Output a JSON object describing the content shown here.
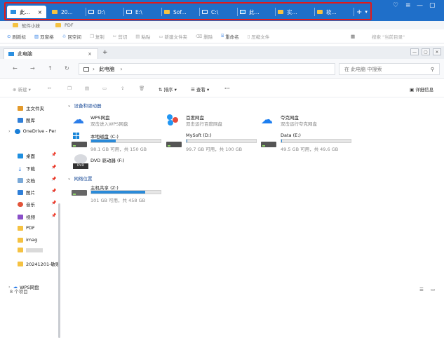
{
  "window_tabs": [
    {
      "label": "此...",
      "icon": "computer-icon",
      "active": true
    },
    {
      "label": "20...",
      "icon": "folder-icon"
    },
    {
      "label": "D:\\",
      "icon": "drive-icon"
    },
    {
      "label": "E:\\",
      "icon": "drive-icon"
    },
    {
      "label": "Sof...",
      "icon": "folder-icon"
    },
    {
      "label": "C:\\",
      "icon": "drive-icon"
    },
    {
      "label": "此...",
      "icon": "computer-icon"
    },
    {
      "label": "实...",
      "icon": "folder-icon"
    },
    {
      "label": "软...",
      "icon": "folder-icon"
    }
  ],
  "tab_close": "×",
  "new_tab": "+",
  "tab_menu": "▾",
  "window_controls": {
    "settings": "♡",
    "menu": "≡",
    "minimize": "—",
    "maximize": "▢"
  },
  "bookmarks": [
    {
      "label": "软件小妹"
    },
    {
      "label": "PDF"
    }
  ],
  "toolbar1": [
    {
      "label": "刷新标",
      "icon": "refresh-icon",
      "enabled": true
    },
    {
      "label": "双窗格",
      "icon": "dual-pane-icon",
      "enabled": true
    },
    {
      "label": "回空间",
      "icon": "recycle-icon",
      "enabled": true
    },
    {
      "label": "复制",
      "icon": "copy-icon",
      "enabled": false
    },
    {
      "label": "剪切",
      "icon": "cut-icon",
      "enabled": false
    },
    {
      "label": "粘贴",
      "icon": "paste-icon",
      "enabled": false
    },
    {
      "label": "新建文件夹",
      "icon": "new-folder-icon",
      "enabled": false
    },
    {
      "label": "删除",
      "icon": "delete-icon",
      "enabled": false
    },
    {
      "label": "重命名",
      "icon": "rename-icon",
      "enabled": true
    },
    {
      "label": "压缩文件",
      "icon": "zip-icon",
      "enabled": false
    }
  ],
  "toolbar1_search": "搜索 \"当前目录\"",
  "inner_tab": {
    "label": "此电脑",
    "close": "×",
    "new": "+"
  },
  "nav": {
    "back": "←",
    "forward": "→",
    "up": "↑",
    "refresh": "↻",
    "breadcrumb": "此电脑",
    "chevron": "›",
    "search_placeholder": "在 此电脑 中搜索"
  },
  "toolbar2": {
    "new": "新建",
    "sort": "排序",
    "view": "查看",
    "more": "···",
    "details": "详细信息"
  },
  "sidebar": {
    "top": [
      {
        "label": "主文件夹"
      },
      {
        "label": "图库"
      },
      {
        "label": "OneDrive - Per"
      }
    ],
    "quick": [
      {
        "label": "桌面",
        "pinned": true
      },
      {
        "label": "下载",
        "pinned": true
      },
      {
        "label": "文档",
        "pinned": true
      },
      {
        "label": "图片",
        "pinned": true
      },
      {
        "label": "音乐",
        "pinned": true
      },
      {
        "label": "视频",
        "pinned": true
      },
      {
        "label": "PDF",
        "pinned": false
      },
      {
        "label": "imag",
        "pinned": false
      },
      {
        "label": "",
        "pinned": false
      },
      {
        "label": "20241201-敏账",
        "pinned": false
      }
    ],
    "bottom": {
      "label": "WPS网盘"
    }
  },
  "sections": {
    "devices": "设备和驱动器",
    "network": "网络位置"
  },
  "cloud": [
    {
      "name": "WPS网盘",
      "sub": "双击进入WPS网盘",
      "color": "#2b7de9"
    },
    {
      "name": "百度网盘",
      "sub": "双击运行百度网盘",
      "color": "#2196f3"
    },
    {
      "name": "夸克网盘",
      "sub": "双击运行夸克网盘",
      "color": "#1c7ef0"
    }
  ],
  "drives": [
    {
      "name": "本地磁盘 (C:)",
      "sub": "98.1 GB 可用，共 150 GB",
      "used": 0.35
    },
    {
      "name": "MySoft (D:)",
      "sub": "99.7 GB 可用，共 100 GB",
      "used": 0.003
    },
    {
      "name": "Data (E:)",
      "sub": "49.5 GB 可用，共 49.6 GB",
      "used": 0.002
    }
  ],
  "dvd": {
    "name": "DVD 驱动器 (F:)",
    "badge": "DVD"
  },
  "network_drive": {
    "name": "主机共享 (Z:)",
    "sub": "101 GB 可用，共 458 GB",
    "used": 0.78
  },
  "status": {
    "count": "8 个项目"
  }
}
